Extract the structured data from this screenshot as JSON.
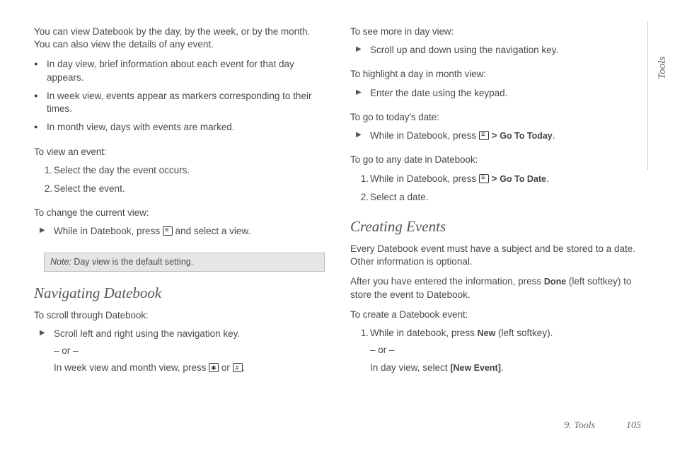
{
  "sideTab": "Tools",
  "footer": {
    "chapter": "9. Tools",
    "page": "105"
  },
  "col1": {
    "intro": "You can view Datebook by the day, by the week, or by the month. You can also view the details of any event.",
    "bullets": [
      "In day view, brief information about each event for that day appears.",
      "In week view, events appear as markers corresponding to their times.",
      "In month view, days with events are marked."
    ],
    "viewEventIntro": "To view an event:",
    "viewEventSteps": [
      "Select the day the event occurs.",
      "Select the event."
    ],
    "changeViewIntro": "To change the current view:",
    "changeViewStepPre": "While in Datebook, press ",
    "changeViewStepPost": " and select a view.",
    "note": {
      "label": "Note:",
      "text": "Day view is the default setting."
    },
    "h_nav": "Navigating Datebook",
    "scrollIntro": "To scroll through Datebook:",
    "scrollStep": "Scroll left and right using the navigation key.",
    "scrollOr": "– or –",
    "scrollAltPre": "In week view and month view, press ",
    "scrollAltMid": " or ",
    "scrollAltPost": "."
  },
  "col2": {
    "seeMoreIntro": "To see more in day view:",
    "seeMoreStep": "Scroll up and down using the navigation key.",
    "highlightIntro": "To highlight a day in month view:",
    "highlightStep": "Enter the date using the keypad.",
    "todayIntro": "To go to today's date:",
    "todayStepPre": "While in Datebook, press ",
    "todayStepGt": " > ",
    "todayStepBold": "Go To Today",
    "todayStepPost": ".",
    "anyDateIntro": "To go to any date in Datebook:",
    "anyDateStep1Pre": "While in Datebook, press ",
    "anyDateStep1Gt": " > ",
    "anyDateStep1Bold": "Go To Date",
    "anyDateStep1Post": ".",
    "anyDateStep2": "Select a date.",
    "h_create": "Creating Events",
    "createPara1": "Every Datebook event must have a subject and be stored to a date. Other information is optional.",
    "createPara2Pre": "After you have entered the information, press ",
    "createPara2Bold": "Done",
    "createPara2Post": " (left softkey) to store the event to Datebook.",
    "createIntro": "To create a Datebook event:",
    "createStep1Pre": "While in datebook, press ",
    "createStep1Bold": "New",
    "createStep1Post": " (left softkey).",
    "createOr": "– or –",
    "createAltPre": "In day view, select ",
    "createAltBold": "[New Event]",
    "createAltPost": "."
  }
}
